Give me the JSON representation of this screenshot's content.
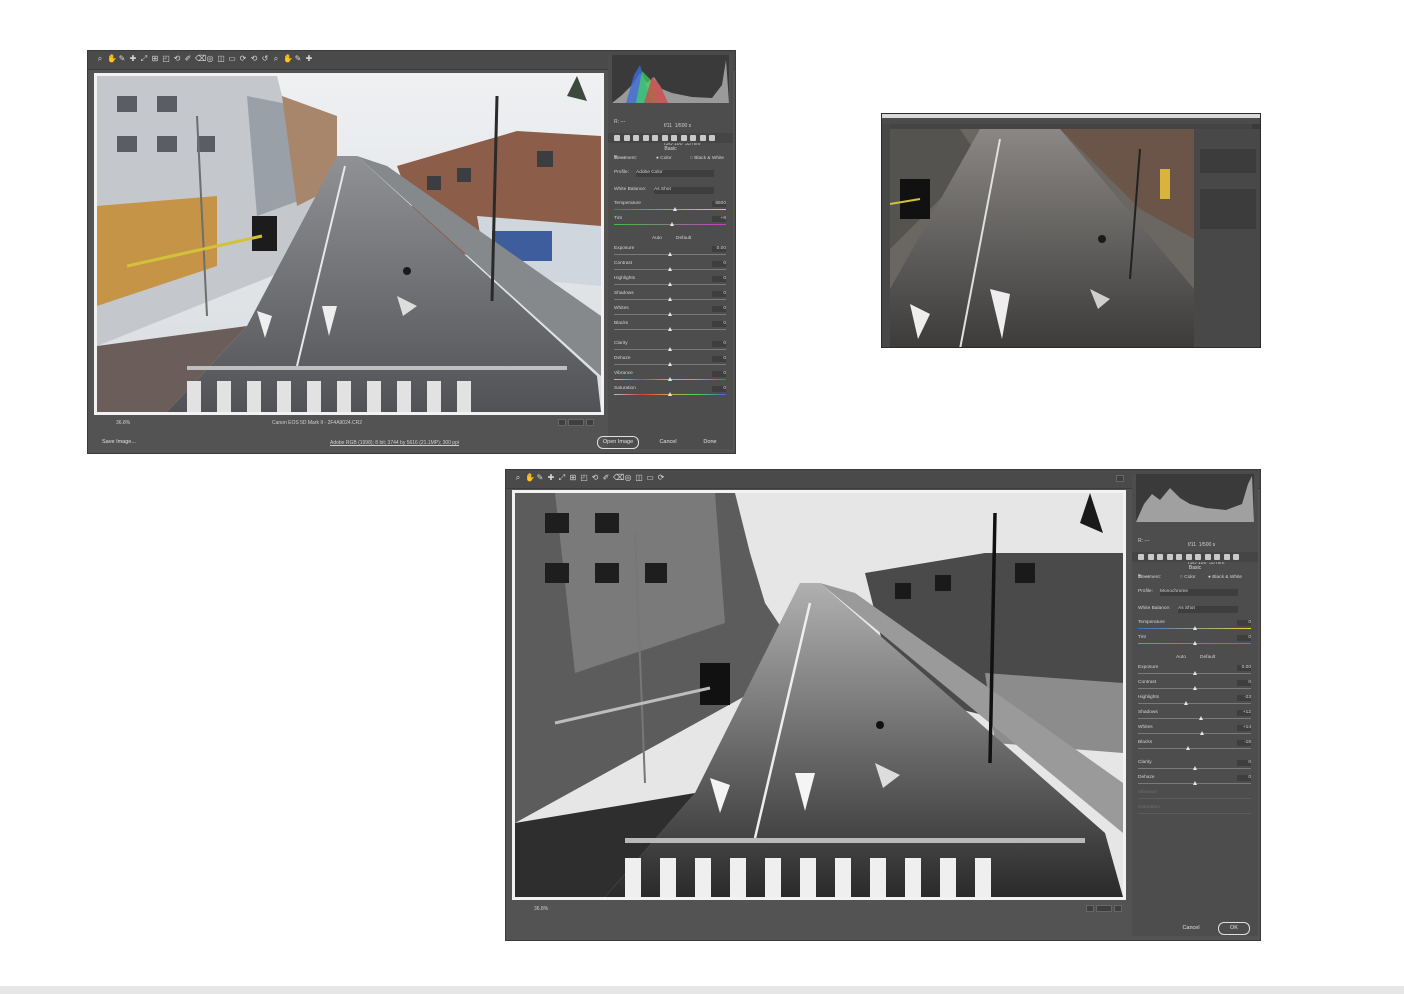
{
  "color_dialog": {
    "zoom": "36.8%",
    "camera": "Canon EOS 5D Mark II - 2F4A9024.CR2",
    "workflow": "Adobe RGB (1998); 8 bit; 3744 by 5616 (21.1MP); 300 ppi",
    "readout": {
      "r_label": "R:",
      "r_val": "---",
      "g_label": "G:",
      "g_val": "---",
      "b_label": "B:",
      "b_val": "---",
      "exif1": "f/11  1/500 s",
      "exif2": "ISO 100  35 mm"
    },
    "panel_title": "Basic",
    "treatment_label": "Treatment:",
    "color_option": "Color",
    "bw_option": "Black & White",
    "profile_label": "Profile:",
    "profile_value": "Adobe Color",
    "wb_label": "White Balance:",
    "wb_value": "As Shot",
    "auto_label": "Auto",
    "default_label": "Default",
    "sliders": [
      {
        "label": "Temperature",
        "value": "6500",
        "pos": 0.55
      },
      {
        "label": "Tint",
        "value": "+8",
        "pos": 0.52
      },
      {
        "label": "Exposure",
        "value": "0.00",
        "pos": 0.5
      },
      {
        "label": "Contrast",
        "value": "0",
        "pos": 0.5
      },
      {
        "label": "Highlights",
        "value": "0",
        "pos": 0.5
      },
      {
        "label": "Shadows",
        "value": "0",
        "pos": 0.5
      },
      {
        "label": "Whites",
        "value": "0",
        "pos": 0.5
      },
      {
        "label": "Blacks",
        "value": "0",
        "pos": 0.5
      },
      {
        "label": "Clarity",
        "value": "0",
        "pos": 0.5
      },
      {
        "label": "Dehaze",
        "value": "0",
        "pos": 0.5
      },
      {
        "label": "Vibrance",
        "value": "0",
        "pos": 0.5
      },
      {
        "label": "Saturation",
        "value": "0",
        "pos": 0.5
      }
    ],
    "save_label": "Save Image...",
    "open_label": "Open Image",
    "cancel_label": "Cancel",
    "done_label": "Done"
  },
  "bw_dialog": {
    "zoom": "36.8%",
    "readout": {
      "r_label": "R:",
      "r_val": "---",
      "g_label": "G:",
      "g_val": "---",
      "b_label": "B:",
      "b_val": "---",
      "exif1": "f/11  1/500 s",
      "exif2": "ISO 100  35 mm"
    },
    "panel_title": "Basic",
    "treatment_label": "Treatment:",
    "color_option": "Color",
    "bw_option": "Black & White",
    "profile_label": "Profile:",
    "profile_value": "Monochrome",
    "wb_label": "White Balance:",
    "wb_value": "As Shot",
    "auto_label": "Auto",
    "default_label": "Default",
    "sliders": [
      {
        "label": "Temperature",
        "value": "0",
        "pos": 0.5
      },
      {
        "label": "Tint",
        "value": "0",
        "pos": 0.5
      },
      {
        "label": "Exposure",
        "value": "0.00",
        "pos": 0.5
      },
      {
        "label": "Contrast",
        "value": "0",
        "pos": 0.5
      },
      {
        "label": "Highlights",
        "value": "-23",
        "pos": 0.42
      },
      {
        "label": "Shadows",
        "value": "+12",
        "pos": 0.56
      },
      {
        "label": "Whites",
        "value": "+14",
        "pos": 0.57
      },
      {
        "label": "Blacks",
        "value": "-18",
        "pos": 0.44
      },
      {
        "label": "Clarity",
        "value": "0",
        "pos": 0.5
      },
      {
        "label": "Dehaze",
        "value": "0",
        "pos": 0.5
      }
    ],
    "dim_sliders": [
      "Vibrance",
      "Saturation"
    ],
    "cancel_label": "Cancel",
    "ok_label": "OK"
  }
}
